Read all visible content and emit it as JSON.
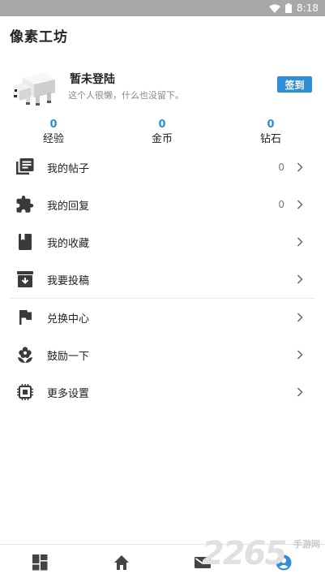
{
  "status_bar": {
    "time": "8:18",
    "wifi_icon": "wifi-icon",
    "battery_icon": "battery-icon"
  },
  "app": {
    "title": "像素工坊"
  },
  "profile": {
    "avatar_icon": "pixel-polar-bear-avatar",
    "name": "暂未登陆",
    "signature": "这个人很懒，什么也没留下。",
    "signin_label": "签到",
    "signin_color": "#2f8fd6"
  },
  "stats": [
    {
      "value": "0",
      "label": "经验"
    },
    {
      "value": "0",
      "label": "金币"
    },
    {
      "value": "0",
      "label": "钻石"
    }
  ],
  "menu": [
    {
      "icon": "posts-icon",
      "label": "我的帖子",
      "count": "0"
    },
    {
      "icon": "puzzle-icon",
      "label": "我的回复",
      "count": "0"
    },
    {
      "icon": "bookmark-book-icon",
      "label": "我的收藏",
      "count": ""
    },
    {
      "icon": "archive-download-icon",
      "label": "我要投稿",
      "count": ""
    },
    {
      "icon": "flag-icon",
      "label": "兑换中心",
      "count": ""
    },
    {
      "icon": "flower-icon",
      "label": "鼓励一下",
      "count": ""
    },
    {
      "icon": "chip-settings-icon",
      "label": "更多设置",
      "count": ""
    }
  ],
  "bottom_nav": [
    {
      "icon": "dashboard-icon"
    },
    {
      "icon": "home-icon"
    },
    {
      "icon": "mail-icon"
    },
    {
      "icon": "account-icon",
      "active": true
    }
  ],
  "watermark": {
    "number": "2265",
    "text": "手游网"
  },
  "colors": {
    "accent": "#2f8fd6",
    "icon": "#3a3a3a",
    "status_bar": "#a8a8a8"
  }
}
